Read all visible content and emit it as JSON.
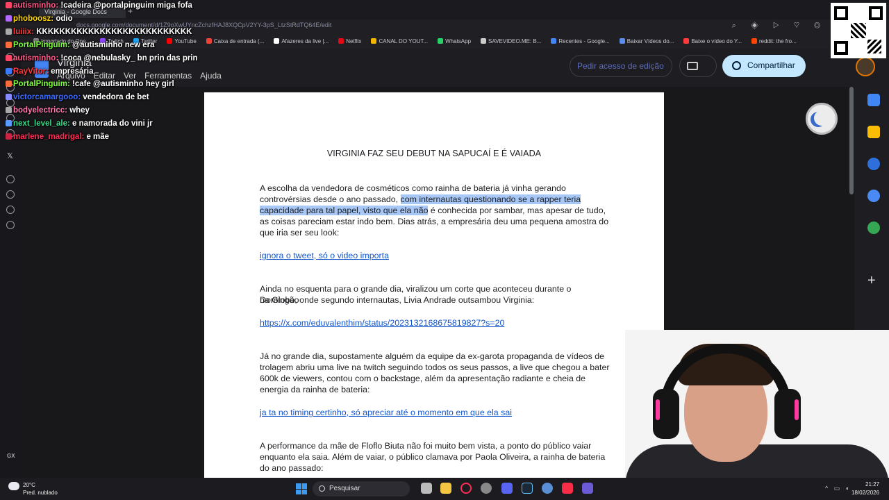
{
  "browser": {
    "tab_title": "Virginia - Google Docs",
    "url": "docs.google.com/document/d/1Z9oXwUYncZchzfHAJ8XQCpV2YY-3pS_LtzStRdTQ64E/edit",
    "bookmarks": [
      {
        "label": "Importado do Ope...",
        "color": "#888888"
      },
      {
        "label": "Twitch",
        "color": "#9146ff"
      },
      {
        "label": "Twitter",
        "color": "#1da1f2"
      },
      {
        "label": "YouTube",
        "color": "#ff0000"
      },
      {
        "label": "Caixa de entrada (...",
        "color": "#ea4335"
      },
      {
        "label": "Afazeres da live |...",
        "color": "#ffffff"
      },
      {
        "label": "Netflix",
        "color": "#e50914"
      },
      {
        "label": "CANAL DO YOUT...",
        "color": "#f4b400"
      },
      {
        "label": "WhatsApp",
        "color": "#25d366"
      },
      {
        "label": "SAVEVIDEO.ME: B...",
        "color": "#cccccc"
      },
      {
        "label": "Recentes - Google...",
        "color": "#4285f4"
      },
      {
        "label": "Baixar Vídeos do...",
        "color": "#5b8def"
      },
      {
        "label": "Baixe o vídeo do Y...",
        "color": "#ff3b3b"
      },
      {
        "label": "reddit: the fro...",
        "color": "#ff4500"
      }
    ]
  },
  "docs": {
    "title": "Virginia",
    "menu": [
      "Arquivo",
      "Editar",
      "Ver",
      "Ferramentas",
      "Ajuda"
    ],
    "request_edit_label": "Pedir acesso de edição",
    "share_label": "Compartilhar"
  },
  "document": {
    "heading": "VIRGINIA FAZ SEU DEBUT NA SAPUCAÍ E É VAIADA",
    "p1_l1": "A escolha da vendedora de cosméticos como rainha de bateria já vinha gerando",
    "p1_l2a": "controvérsias desde o ano passado, ",
    "p1_l2b": "com internautas questionando se a rapper teria",
    "p1_l3a": "capacidade para tal papel, visto que ela não",
    "p1_l3b": " é conhecida por sambar, mas apesar de tudo,",
    "p1_l4": "as coisas pareciam estar indo bem. Dias atrás, a empresária deu uma pequena amostra do",
    "p1_l5": "que iria ser seu look:",
    "link1": "ignora o tweet, só o video importa",
    "p2_l1": "Ainda no esquenta para o grande dia, viralizou um corte que aconteceu durante o Domingão",
    "p2_l2": "na Globo, onde segundo internautas, Livia Andrade outsambou Virginia:",
    "link2": "https://x.com/eduvalenthim/status/2023132168675819827?s=20",
    "p3_l1": "Já no grande dia, supostamente alguém da equipe da ex-garota propaganda de vídeos de",
    "p3_l2": "trolagem abriu uma live na twitch seguindo todos os seus passos, a live que chegou a bater",
    "p3_l3": "600k de viewers, contou com o backstage, além da apresentação radiante e cheia de",
    "p3_l4": "energia da rainha de bateria:",
    "link3": "ja ta no timing certinho, só apreciar até o momento em que ela sai",
    "p4_l1": "A performance da mãe de Floflo Biuta não foi muito bem vista, a ponto do público vaiar",
    "p4_l2": "enquanto ela saia. Além de vaiar, o público clamava por Paola Oliveira, a rainha de bateria",
    "p4_l3": "do ano passado:"
  },
  "chat": [
    {
      "user": "autisminho",
      "color": "#ff5a8a",
      "badge": "#ff4466",
      "msg": "!cadeira @portalpinguim miga fofa"
    },
    {
      "user": "phoboosz",
      "color": "#ffd400",
      "badge": "#b36bff",
      "msg": "odio"
    },
    {
      "user": "luiiix",
      "color": "#ff3b3b",
      "badge": "#aaaaaa",
      "msg": "KKKKKKKKKKKKKKKKKKKKKKKKKKK"
    },
    {
      "user": "PortalPinguim",
      "color": "#7cff3b",
      "badge": "#ff6b3b",
      "msg": "@autisminho new era"
    },
    {
      "user": "autisminho",
      "color": "#ff5a8a",
      "badge": "#ff4466",
      "msg": "!coca @nebulasky_ bn prin das prin"
    },
    {
      "user": "RayVitor",
      "color": "#ff3b3b",
      "badge": "#3b7bff",
      "msg": "empresária"
    },
    {
      "user": "PortalPinguim",
      "color": "#7cff3b",
      "badge": "#ff6b3b",
      "msg": "!cafe @autisminho hey girl"
    },
    {
      "user": "victorcamargooo",
      "color": "#3b6bff",
      "badge": "#8a8aff",
      "msg": "vendedora de bet"
    },
    {
      "user": "bodyelectricc",
      "color": "#ff7ab0",
      "badge": "#aaaaaa",
      "msg": "whey"
    },
    {
      "user": "next_level_ale",
      "color": "#3bdb8a",
      "badge": "#5b9bff",
      "msg": "e namorada do vini jr"
    },
    {
      "user": "marlene_madrigal",
      "color": "#ff2d55",
      "badge": "#cc2244",
      "msg": "e mãe"
    }
  ],
  "taskbar": {
    "weather_temp": "20°C",
    "weather_desc": "Pred. nublado",
    "search_label": "Pesquisar",
    "time": "21:27",
    "date": "18/02/2026"
  },
  "sidebar": {
    "gx_label": "GX"
  }
}
